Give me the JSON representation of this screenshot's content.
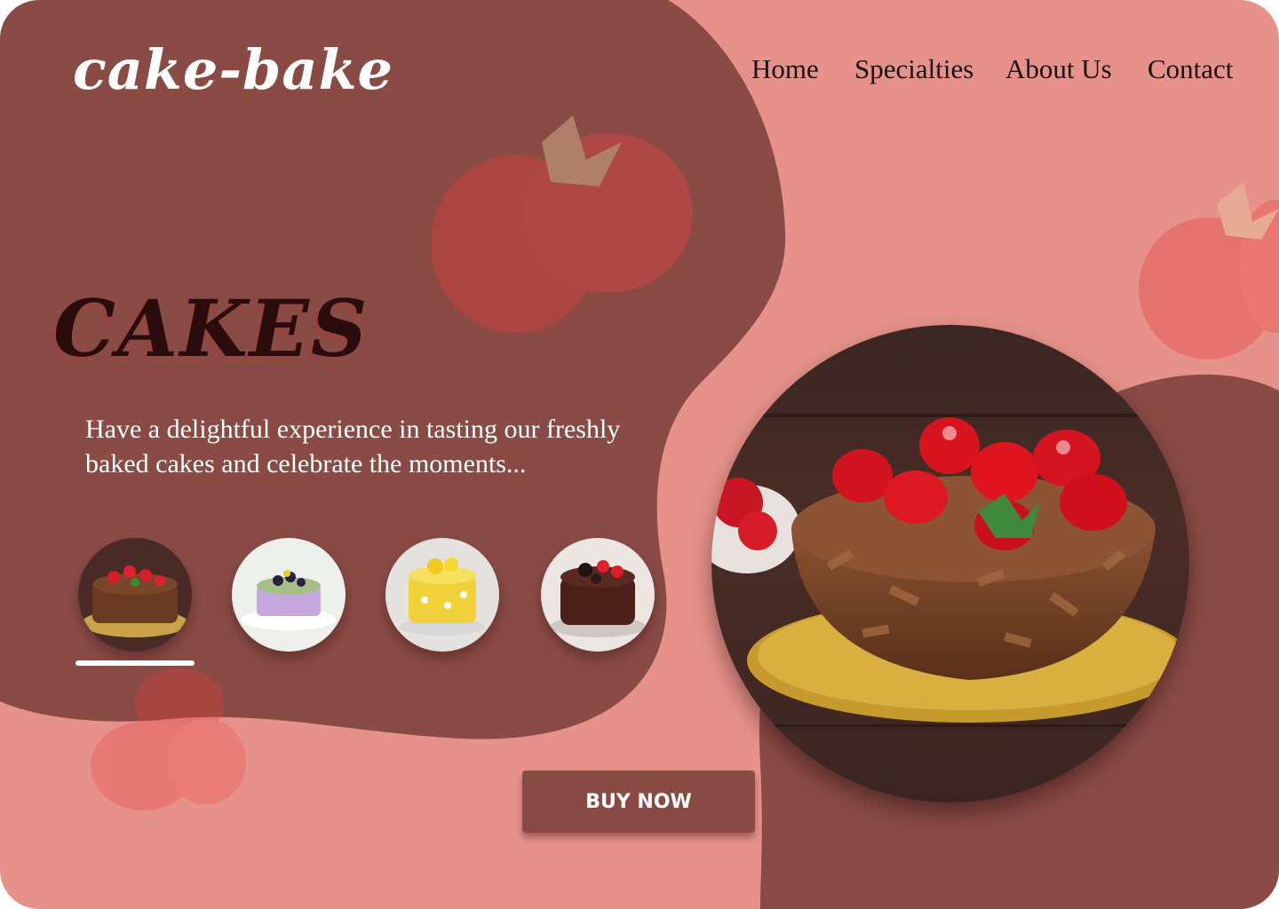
{
  "brand": {
    "logo_text": "cake-bake"
  },
  "nav": {
    "items": [
      {
        "label": "Home"
      },
      {
        "label": "Specialties"
      },
      {
        "label": "About Us"
      },
      {
        "label": "Contact"
      }
    ]
  },
  "hero": {
    "title": "CAKES",
    "description": "Have a delightful experience in tasting our freshly baked cakes and celebrate the moments..."
  },
  "gallery": {
    "selected_index": 0,
    "thumbnails": [
      {
        "icon": "chocolate-strawberry-cake-icon"
      },
      {
        "icon": "blackberry-cheesecake-icon"
      },
      {
        "icon": "yellow-flower-cake-icon"
      },
      {
        "icon": "chocolate-oreo-cake-icon"
      }
    ]
  },
  "cta": {
    "buy_label": "BUY NOW"
  },
  "colors": {
    "dark_brown": "#8a4b45",
    "salmon": "#e6928a",
    "title": "#2a0c0c",
    "button": "#8a4a44"
  }
}
